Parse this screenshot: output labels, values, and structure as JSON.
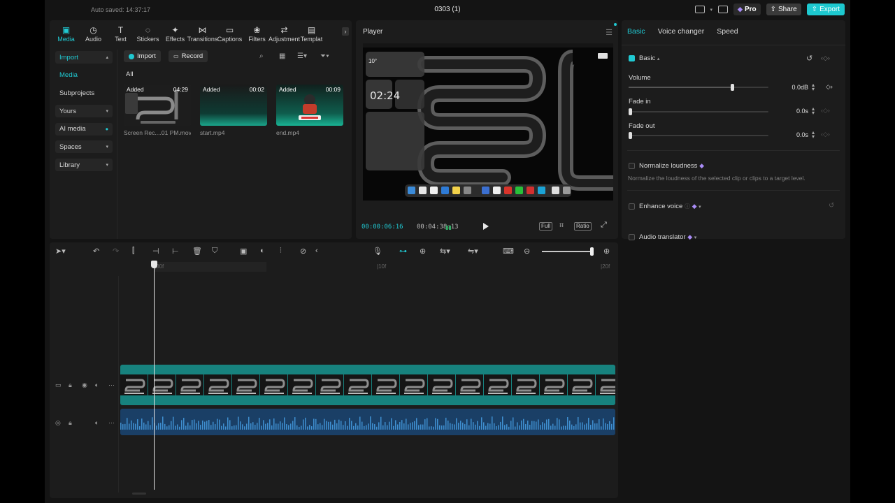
{
  "window": {
    "autosave": "Auto saved: 14:37:17",
    "title": "0303 (1)",
    "pro_label": "Pro",
    "share_label": "Share",
    "export_label": "Export"
  },
  "media": {
    "tools": [
      {
        "label": "Media",
        "icon": "media-icon",
        "active": true
      },
      {
        "label": "Audio",
        "icon": "audio-icon"
      },
      {
        "label": "Text",
        "icon": "text-icon"
      },
      {
        "label": "Stickers",
        "icon": "stickers-icon"
      },
      {
        "label": "Effects",
        "icon": "effects-icon"
      },
      {
        "label": "Transitions",
        "icon": "transitions-icon"
      },
      {
        "label": "Captions",
        "icon": "captions-icon"
      },
      {
        "label": "Filters",
        "icon": "filters-icon"
      },
      {
        "label": "Adjustment",
        "icon": "adjustment-icon"
      },
      {
        "label": "Templat",
        "icon": "templates-icon"
      }
    ],
    "sidebar": [
      {
        "label": "Import",
        "accent": true,
        "chevron": "▴",
        "highlight": true
      },
      {
        "label": "Media",
        "accent": true,
        "highlight": false
      },
      {
        "label": "Subprojects"
      },
      {
        "label": "Yours",
        "chevron": "▾",
        "highlight": true
      },
      {
        "label": "AI media",
        "chevron": "•",
        "highlight": true
      },
      {
        "label": "Spaces",
        "chevron": "▾",
        "highlight": true
      },
      {
        "label": "Library",
        "chevron": "▾",
        "highlight": true
      }
    ],
    "import_label": "Import",
    "record_label": "Record",
    "filter_all": "All",
    "items": [
      {
        "badge": "Added",
        "duration": "04:29",
        "name": "Screen Rec....01 PM.mov"
      },
      {
        "badge": "Added",
        "duration": "00:02",
        "name": "start.mp4"
      },
      {
        "badge": "Added",
        "duration": "00:09",
        "name": "end.mp4"
      }
    ]
  },
  "player": {
    "title": "Player",
    "current_time": "00:00:06:16",
    "total_time": "00:04:38:13",
    "full_label": "Full",
    "ratio_label": "Ratio",
    "video_clock": "02:24",
    "video_temp": "10°"
  },
  "properties": {
    "tabs": [
      "Basic",
      "Voice changer",
      "Speed"
    ],
    "section_basic": "Basic",
    "volume_label": "Volume",
    "volume_value": "0.0dB",
    "volume_level": 0.75,
    "fade_in_label": "Fade in",
    "fade_in_value": "0.0s",
    "fade_out_label": "Fade out",
    "fade_out_value": "0.0s",
    "normalize_label": "Normalize loudness",
    "normalize_note": "Normalize the loudness of the selected clip or clips to a target level.",
    "enhance_label": "Enhance voice",
    "translator_label": "Audio translator"
  },
  "timeline": {
    "ruler": [
      "|00f",
      "|10f",
      "|20f"
    ],
    "colors": {
      "accent": "#20c9d2",
      "video_clip": "#17827e",
      "audio_clip": "#1a3f66"
    }
  }
}
